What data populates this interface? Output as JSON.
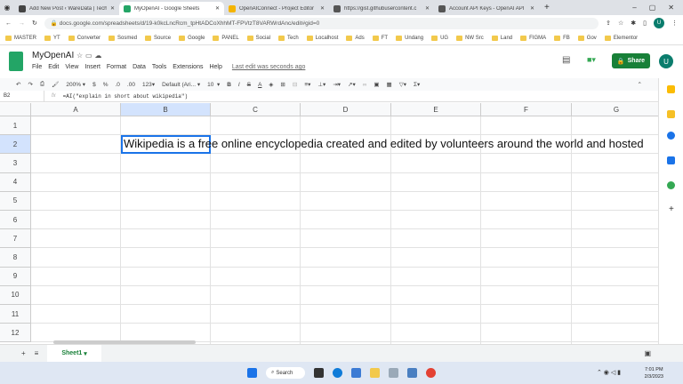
{
  "browser": {
    "tabs": [
      {
        "label": "Add New Post ‹ WareData | Tech",
        "color": "#444",
        "active": false
      },
      {
        "label": "MyOpenAI - Google Sheets",
        "color": "#23a566",
        "active": true
      },
      {
        "label": "OpenAIConnect - Project Editor",
        "color": "#f4b400",
        "active": false
      },
      {
        "label": "https://gist.githubusercontent.c",
        "color": "#555",
        "active": false
      },
      {
        "label": "Account API Keys - OpenAI API",
        "color": "#555",
        "active": false
      }
    ],
    "url": "docs.google.com/spreadsheets/d/19-k0kcLncRcm_tpHtADCoXhhMT-FPVtzT8VARWrdAnc/edit#gid=0",
    "profile_initial": "U",
    "bookmarks": [
      "MASTER",
      "YT",
      "Converter",
      "Sosmed",
      "Source",
      "Google",
      "PANEL",
      "Social",
      "Tech",
      "Localhost",
      "Ads",
      "FT",
      "Undang",
      "UG",
      "NW Src",
      "Land",
      "FIGMA",
      "FB",
      "Gov",
      "Elementor"
    ]
  },
  "sheets": {
    "title": "MyOpenAI",
    "menu": [
      "File",
      "Edit",
      "View",
      "Insert",
      "Format",
      "Data",
      "Tools",
      "Extensions",
      "Help"
    ],
    "last_edit": "Last edit was seconds ago",
    "share_label": "Share",
    "avatar": "U",
    "toolbar": {
      "zoom": "200%",
      "currency": "$",
      "percent": "%",
      "dec_dec": ".0",
      "inc_dec": ".00",
      "format": "123",
      "font": "Default (Ari...",
      "size": "10",
      "bold": "B",
      "italic": "I",
      "strike": "S",
      "textcolor": "A",
      "sum": "Σ"
    },
    "name_box": "B2",
    "fx": "fx",
    "formula": "=AI(\"explain in short about wikipedia\")",
    "columns": [
      "A",
      "B",
      "C",
      "D",
      "E",
      "F",
      "G"
    ],
    "rows": [
      "1",
      "2",
      "3",
      "4",
      "5",
      "6",
      "7",
      "8",
      "9",
      "10",
      "11",
      "12"
    ],
    "cell_B2": "Wikipedia is a free online encyclopedia created and edited by volunteers around the world and hosted",
    "sheet_tab": "Sheet1"
  },
  "taskbar": {
    "search": "Search",
    "time": "7:01 PM",
    "date": "2/3/2023"
  },
  "colors": {
    "accent": "#188038",
    "selection": "#1a73e8"
  }
}
